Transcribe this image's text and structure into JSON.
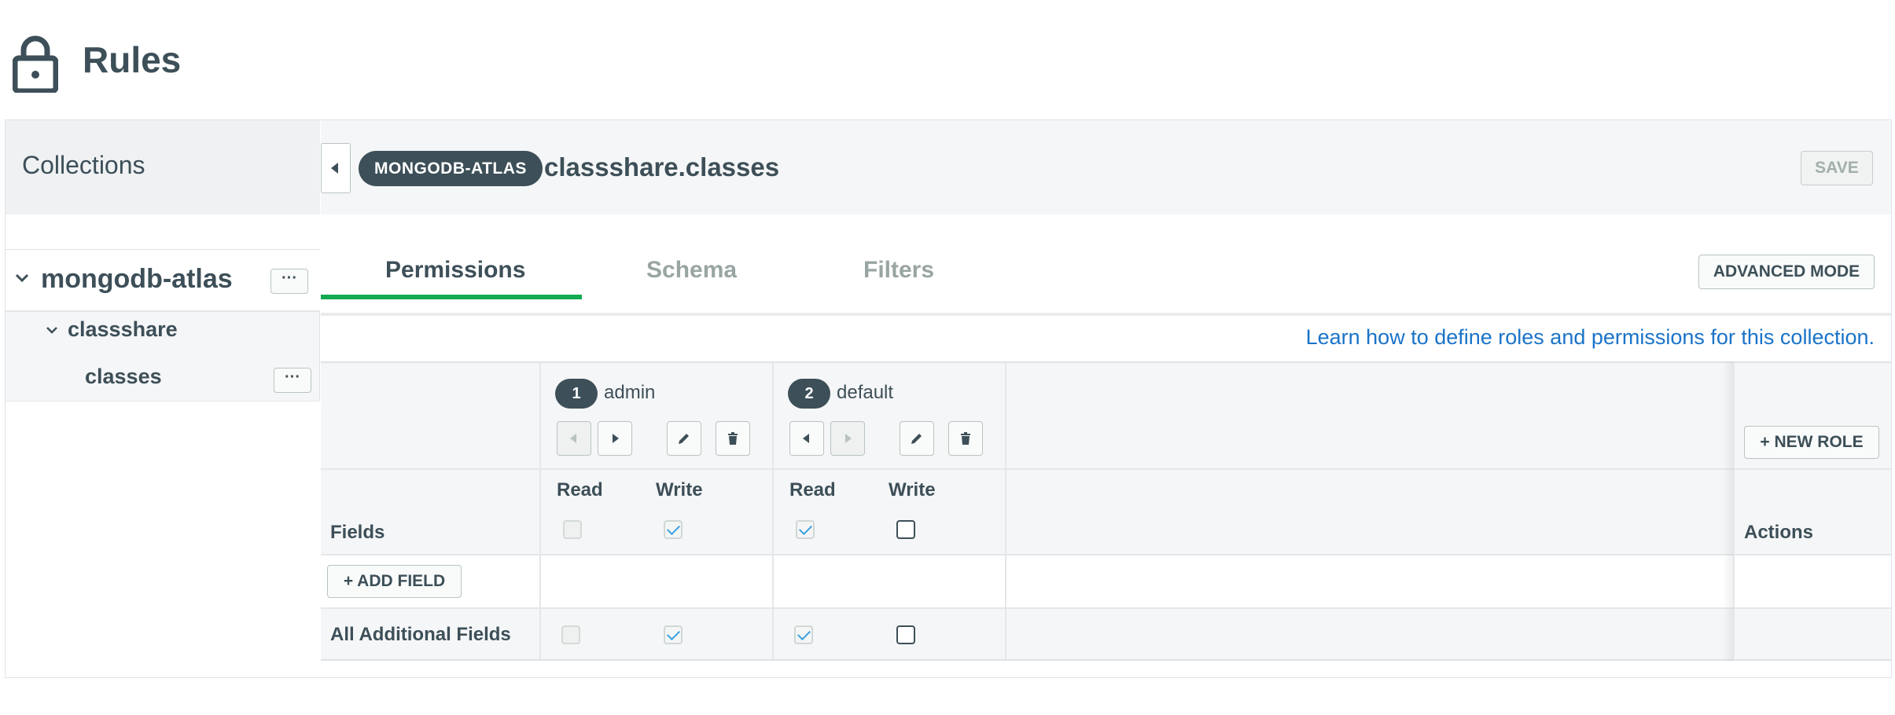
{
  "page": {
    "title": "Rules"
  },
  "sidebar": {
    "title": "Collections",
    "database": {
      "name": "mongodb-atlas",
      "menu_label": "···"
    },
    "collection_group": {
      "name": "classshare"
    },
    "collection": {
      "name": "classes",
      "menu_label": "···"
    }
  },
  "header": {
    "service_badge": "MONGODB-ATLAS",
    "collection_name": "classshare.classes",
    "save_label": "SAVE"
  },
  "tabs": [
    {
      "label": "Permissions",
      "active": true
    },
    {
      "label": "Schema",
      "active": false
    },
    {
      "label": "Filters",
      "active": false
    }
  ],
  "advanced_mode_label": "ADVANCED MODE",
  "help_link": "Learn how to define roles and permissions for this collection.",
  "table": {
    "roles": [
      {
        "number": "1",
        "name": "admin",
        "read_label": "Read",
        "write_label": "Write",
        "header_read": "disabled",
        "header_write": "checked",
        "row_read": "disabled",
        "row_write": "checked"
      },
      {
        "number": "2",
        "name": "default",
        "read_label": "Read",
        "write_label": "Write",
        "header_read": "checked",
        "header_write": "empty",
        "row_read": "checked",
        "row_write": "empty"
      }
    ],
    "new_role_label": "+ NEW ROLE",
    "fields_label": "Fields",
    "actions_label": "Actions",
    "add_field_label": "+ ADD FIELD",
    "row_label": "All Additional Fields"
  },
  "colors": {
    "text": "#3d4f58",
    "accent_green": "#13aa52",
    "link_blue": "#1a73c8",
    "check_blue": "#3b9fe0"
  }
}
